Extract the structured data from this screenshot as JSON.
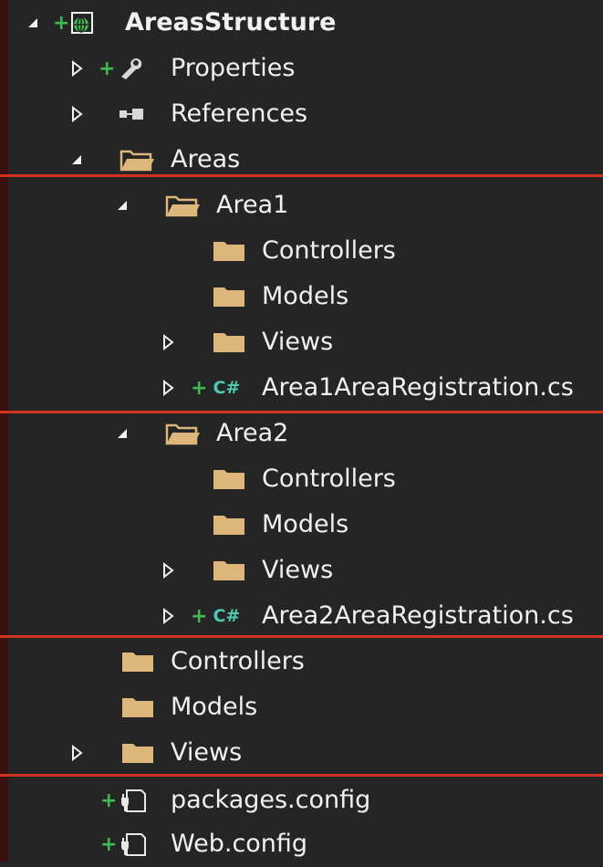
{
  "tree": {
    "root": {
      "label": "AreasStructure",
      "icon": "web-project-icon",
      "expanded": true
    },
    "items": [
      {
        "label": "Properties",
        "icon": "wrench-icon",
        "toggle": "collapsed"
      },
      {
        "label": "References",
        "icon": "references-icon",
        "toggle": "collapsed"
      },
      {
        "label": "Areas",
        "icon": "folder-open-icon",
        "toggle": "expanded"
      },
      {
        "label": "Area1",
        "icon": "folder-open-icon",
        "toggle": "expanded"
      },
      {
        "label": "Controllers",
        "icon": "folder-icon",
        "toggle": "none"
      },
      {
        "label": "Models",
        "icon": "folder-icon",
        "toggle": "none"
      },
      {
        "label": "Views",
        "icon": "folder-icon",
        "toggle": "collapsed"
      },
      {
        "label": "Area1AreaRegistration.cs",
        "icon": "csharp-file-icon",
        "toggle": "collapsed"
      },
      {
        "label": "Area2",
        "icon": "folder-open-icon",
        "toggle": "expanded"
      },
      {
        "label": "Controllers",
        "icon": "folder-icon",
        "toggle": "none"
      },
      {
        "label": "Models",
        "icon": "folder-icon",
        "toggle": "none"
      },
      {
        "label": "Views",
        "icon": "folder-icon",
        "toggle": "collapsed"
      },
      {
        "label": "Area2AreaRegistration.cs",
        "icon": "csharp-file-icon",
        "toggle": "collapsed"
      },
      {
        "label": "Controllers",
        "icon": "folder-icon",
        "toggle": "none"
      },
      {
        "label": "Models",
        "icon": "folder-icon",
        "toggle": "none"
      },
      {
        "label": "Views",
        "icon": "folder-icon",
        "toggle": "collapsed"
      },
      {
        "label": "packages.config",
        "icon": "config-file-icon",
        "toggle": "none"
      },
      {
        "label": "Web.config",
        "icon": "config-file-icon",
        "toggle": "none"
      }
    ],
    "csharp_glyph": "C#",
    "added_marker": "+"
  },
  "colors": {
    "background": "#252526",
    "text": "#f1f1f1",
    "folder": "#dcb67a",
    "added": "#3fb950",
    "csharp": "#4ec9b0",
    "highlight_separator": "#d2331f"
  }
}
